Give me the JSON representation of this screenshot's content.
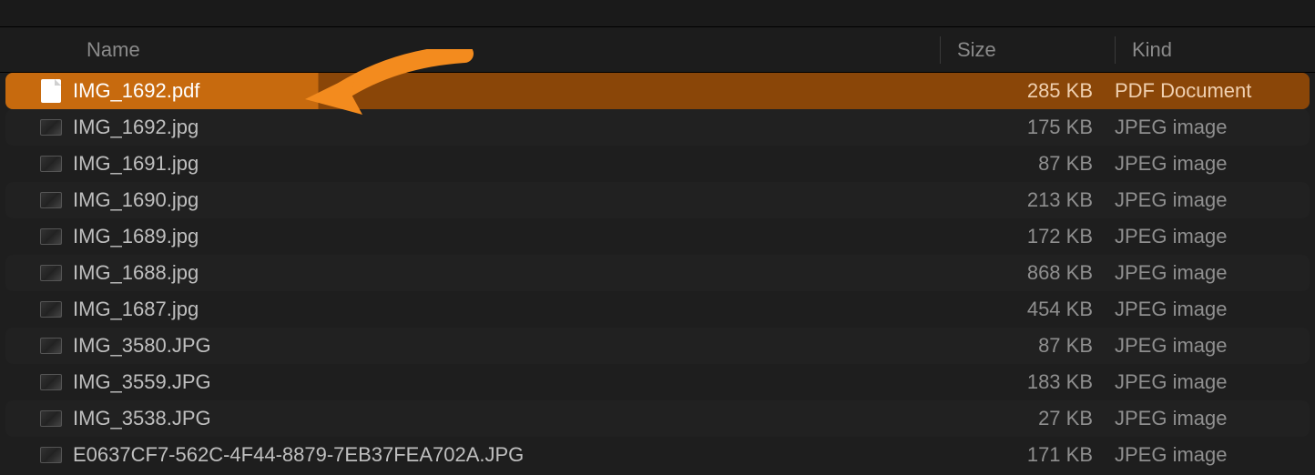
{
  "header": {
    "name_label": "Name",
    "size_label": "Size",
    "kind_label": "Kind"
  },
  "files": [
    {
      "name": "IMG_1692.pdf",
      "size": "285 KB",
      "kind": "PDF Document",
      "icon": "pdf",
      "selected": true
    },
    {
      "name": "IMG_1692.jpg",
      "size": "175 KB",
      "kind": "JPEG image",
      "icon": "jpg",
      "selected": false
    },
    {
      "name": "IMG_1691.jpg",
      "size": "87 KB",
      "kind": "JPEG image",
      "icon": "jpg",
      "selected": false
    },
    {
      "name": "IMG_1690.jpg",
      "size": "213 KB",
      "kind": "JPEG image",
      "icon": "jpg",
      "selected": false
    },
    {
      "name": "IMG_1689.jpg",
      "size": "172 KB",
      "kind": "JPEG image",
      "icon": "jpg",
      "selected": false
    },
    {
      "name": "IMG_1688.jpg",
      "size": "868 KB",
      "kind": "JPEG image",
      "icon": "jpg",
      "selected": false
    },
    {
      "name": "IMG_1687.jpg",
      "size": "454 KB",
      "kind": "JPEG image",
      "icon": "jpg",
      "selected": false
    },
    {
      "name": "IMG_3580.JPG",
      "size": "87 KB",
      "kind": "JPEG image",
      "icon": "jpg",
      "selected": false
    },
    {
      "name": "IMG_3559.JPG",
      "size": "183 KB",
      "kind": "JPEG image",
      "icon": "jpg",
      "selected": false
    },
    {
      "name": "IMG_3538.JPG",
      "size": "27 KB",
      "kind": "JPEG image",
      "icon": "jpg",
      "selected": false
    },
    {
      "name": "E0637CF7-562C-4F44-8879-7EB37FEA702A.JPG",
      "size": "171 KB",
      "kind": "JPEG image",
      "icon": "jpg",
      "selected": false
    }
  ],
  "annotation": {
    "type": "arrow",
    "color": "#f38b1e"
  }
}
